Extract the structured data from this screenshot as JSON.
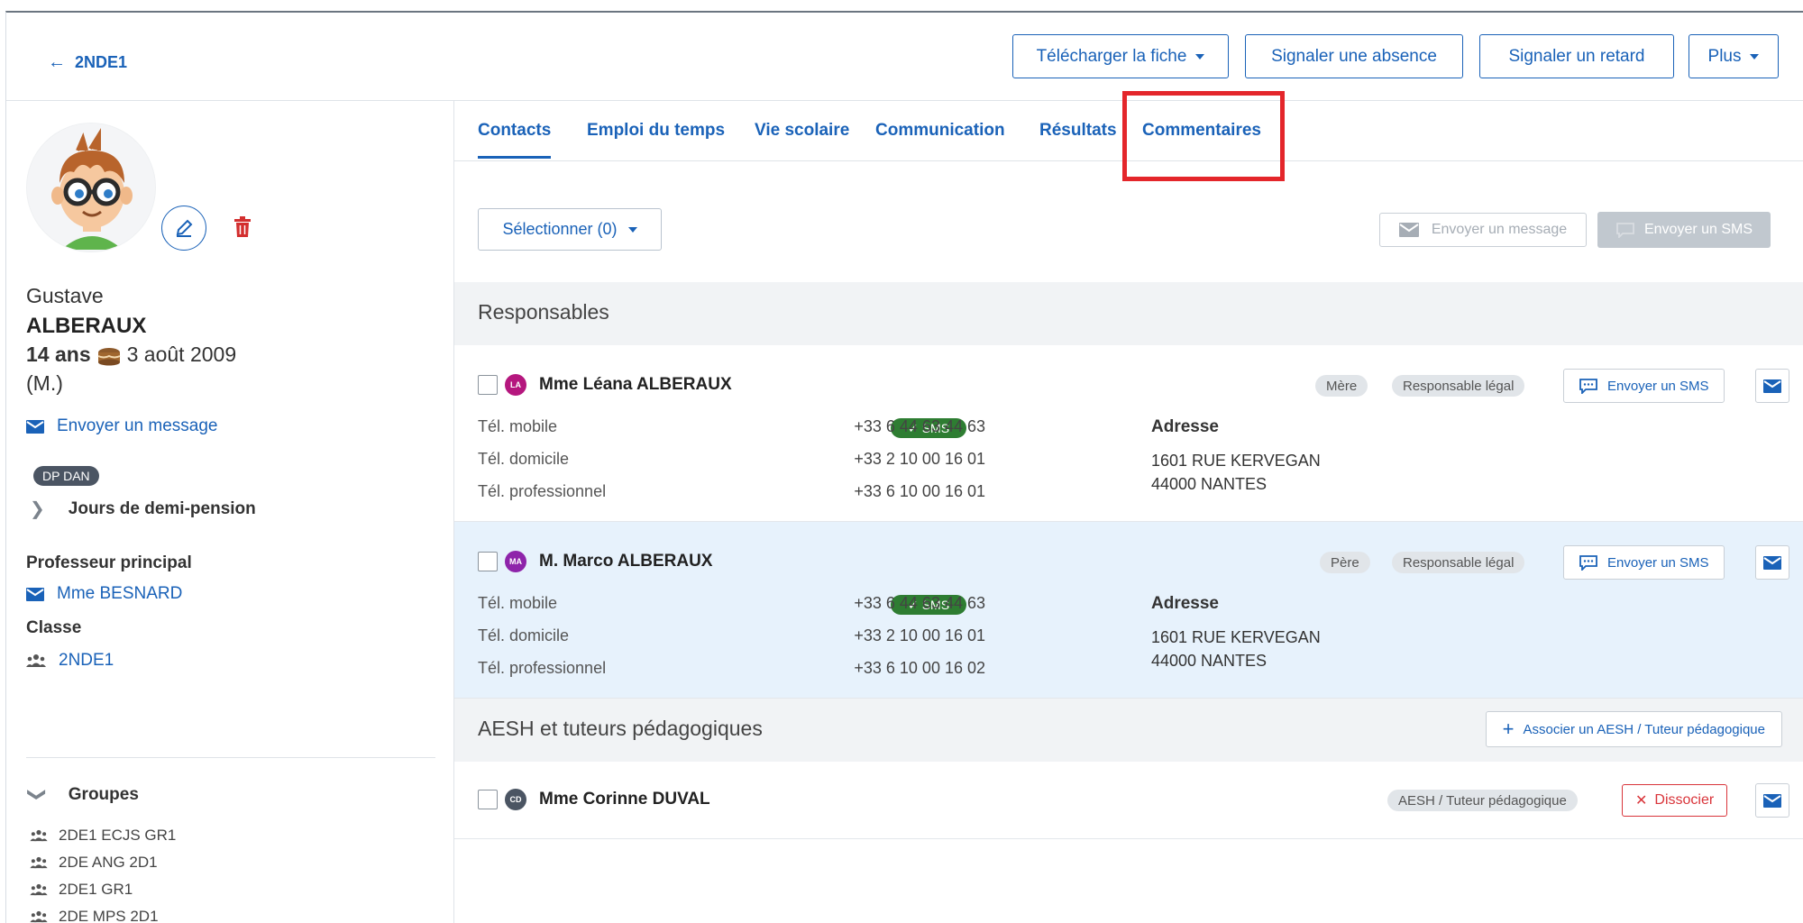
{
  "header": {
    "back_label": "2NDE1",
    "buttons": {
      "download": "Télécharger la fiche",
      "absence": "Signaler une absence",
      "delay": "Signaler un retard",
      "more": "Plus"
    }
  },
  "student": {
    "first_name": "Gustave",
    "last_name": "ALBERAUX",
    "age": "14 ans",
    "birthdate": "3 août 2009",
    "sex": "(M.)",
    "send_message": "Envoyer un message",
    "badge": "DP DAN",
    "half_board_toggle": "Jours de demi-pension",
    "main_teacher_label": "Professeur principal",
    "main_teacher": "Mme BESNARD",
    "class_label": "Classe",
    "class_name": "2NDE1",
    "groups_label": "Groupes",
    "groups": [
      "2DE1 ECJS GR1",
      "2DE ANG 2D1",
      "2DE1 GR1",
      "2DE MPS 2D1"
    ]
  },
  "tabs": [
    "Contacts",
    "Emploi du temps",
    "Vie scolaire",
    "Communication",
    "Résultats",
    "Commentaires"
  ],
  "toolbar": {
    "select": "Sélectionner (0)",
    "send_message": "Envoyer un message",
    "send_sms": "Envoyer un SMS"
  },
  "responsables": {
    "title": "Responsables",
    "labels": {
      "mobile": "Tél. mobile",
      "home": "Tél. domicile",
      "work": "Tél. professionnel",
      "address": "Adresse",
      "sms": "SMS",
      "sms_button": "Envoyer un SMS"
    },
    "contacts": [
      {
        "initials": "LA",
        "name": "Mme Léana ALBERAUX",
        "relation": "Mère",
        "role": "Responsable légal",
        "mobile": "+33 6 44 63 44 63",
        "home": "+33 2 10 00 16 01",
        "work": "+33 6 10 00 16 01",
        "address_line1": "1601 RUE KERVEGAN",
        "address_line2": "44000 NANTES"
      },
      {
        "initials": "MA",
        "name": "M. Marco ALBERAUX",
        "relation": "Père",
        "role": "Responsable légal",
        "mobile": "+33 6 44 63 44 63",
        "home": "+33 2 10 00 16 01",
        "work": "+33 6 10 00 16 02",
        "address_line1": "1601 RUE KERVEGAN",
        "address_line2": "44000 NANTES"
      }
    ]
  },
  "aesh": {
    "title": "AESH et tuteurs pédagogiques",
    "associate_button": "Associer un AESH / Tuteur pédagogique",
    "contact": {
      "initials": "CD",
      "name": "Mme Corinne DUVAL",
      "role": "AESH / Tuteur pédagogique",
      "dissociate": "Dissocier"
    }
  },
  "colors": {
    "primary": "#1a62b8",
    "highlight": "#e4262b",
    "sms_green": "#2e7d32",
    "row_alt": "#e7f2fc",
    "initials_la": "#b5177e",
    "initials_ma": "#8e24aa",
    "initials_cd": "#4b5563"
  }
}
